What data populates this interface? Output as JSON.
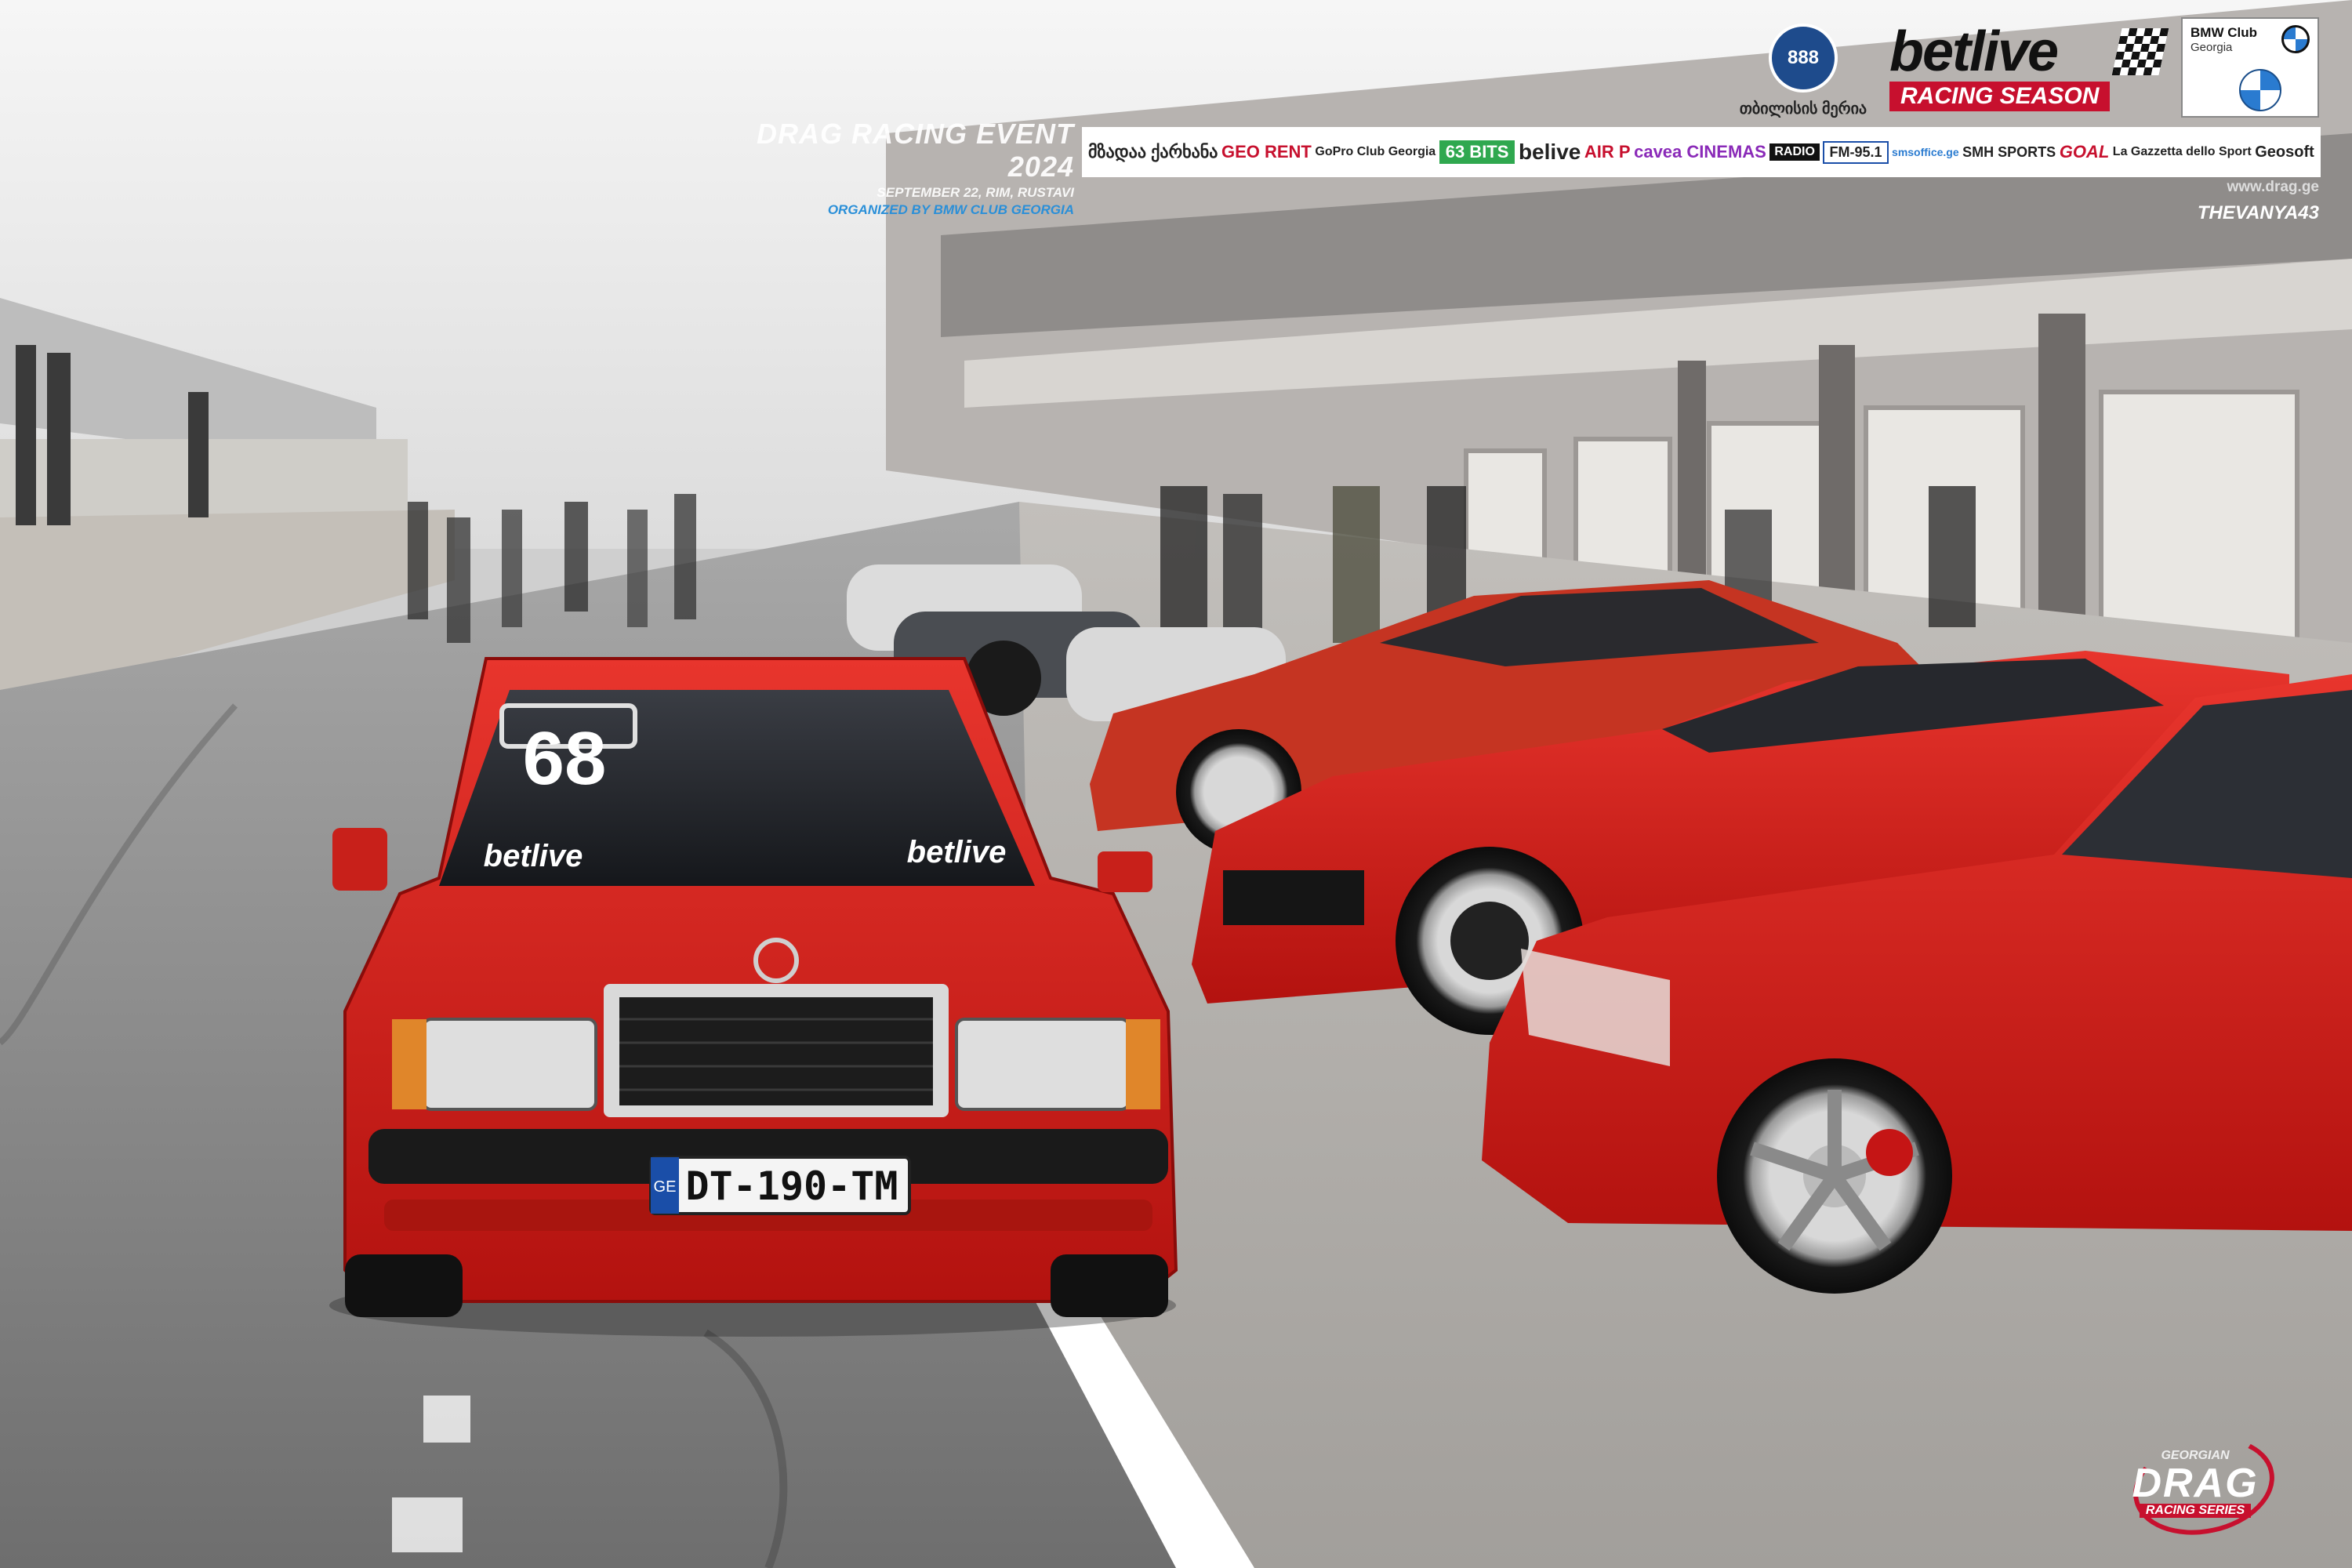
{
  "event": {
    "title": "DRAG RACING EVENT 2024",
    "date_location": "SEPTEMBER 22, RIM, RUSTAVI",
    "organizer": "ORGANIZED BY BMW CLUB GEORGIA"
  },
  "logos": {
    "tbilisi_initials": "888",
    "tbilisi_text": "თბილისის მერია",
    "belive_word": "betlive",
    "belive_season": "RACING SEASON",
    "bmw_title": "BMW Club",
    "bmw_country": "Georgia"
  },
  "sponsors": [
    "მზადაა ქარხანა",
    "GEO RENT",
    "GoPro Club Georgia",
    "63 BITS",
    "belive",
    "AIR P",
    "cavea CINEMAS",
    "RADIO",
    "FM-95.1",
    "smsoffice.ge",
    "SMH SPORTS",
    "GOAL",
    "La Gazzetta dello Sport",
    "Geosoft"
  ],
  "site_url": "www.drag.ge",
  "photographer": "THEVANYA43",
  "car": {
    "race_number": "68",
    "windshield_sticker": "betlive",
    "plate_country": "GE",
    "plate": "DT-190-TM"
  },
  "series_logo": {
    "top": "GEORGIAN",
    "main": "DRAG",
    "bottom": "RACING SERIES"
  },
  "colors": {
    "car_red": "#d21d1d",
    "asphalt": "#8a8a8a",
    "sky": "#efefef",
    "accent_blue": "#2a8fd8",
    "brand_red": "#c7102e"
  }
}
